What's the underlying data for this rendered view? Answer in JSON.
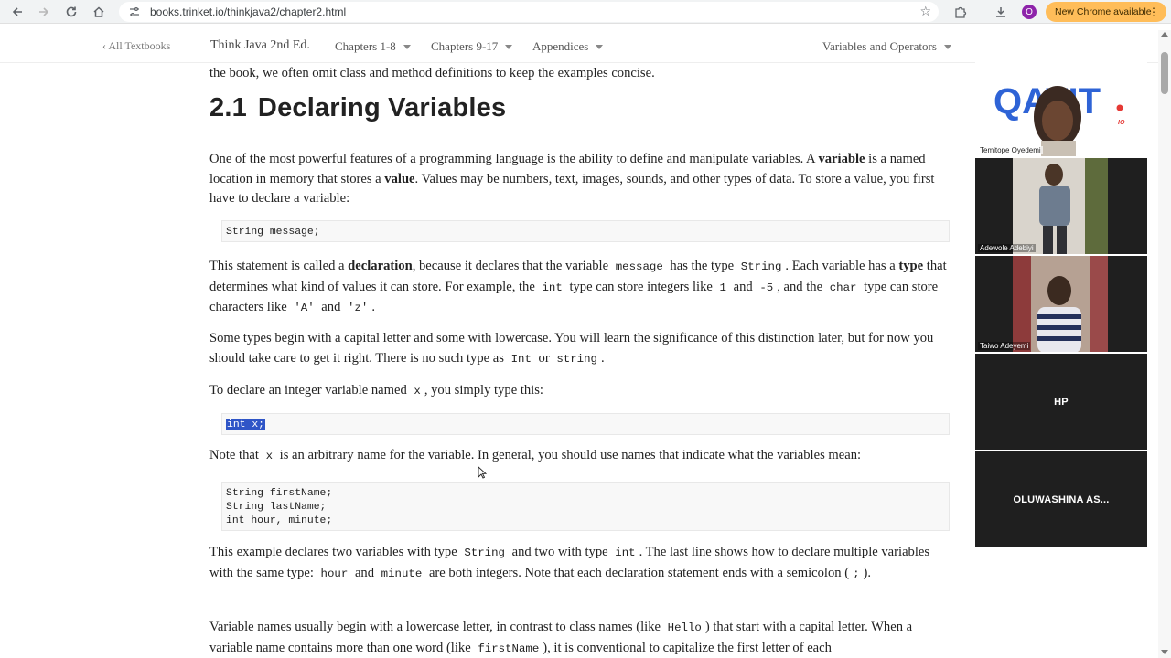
{
  "browser": {
    "url": "books.trinket.io/thinkjava2/chapter2.html",
    "update_label": "New Chrome available",
    "profile_initial": "O"
  },
  "site_nav": {
    "back_link": "‹ All Textbooks",
    "book_title": "Think Java 2nd Ed.",
    "menus": [
      "Chapters 1-8",
      "Chapters 9-17",
      "Appendices"
    ],
    "section_menu": "Variables and Operators"
  },
  "content": {
    "intro_tail": "the book, we often omit class and method definitions to keep the examples concise.",
    "section_number": "2.1",
    "section_title": "Declaring Variables",
    "p1": {
      "a": "One of the most powerful features of a programming language is the ability to define and manipulate variables. A ",
      "b": "variable",
      "c": " is a named location in memory that stores a ",
      "d": "value",
      "e": ". Values may be numbers, text, images, sounds, and other types of data. To store a value, you first have to declare a variable:"
    },
    "code1": "String message;",
    "p2": {
      "a": "This statement is called a ",
      "b": "declaration",
      "c": ", because it declares that the variable ",
      "code_message": "message",
      "d": " has the type ",
      "code_string": "String",
      "e": ". Each variable has a ",
      "f": "type",
      "g": " that determines what kind of values it can store. For example, the ",
      "code_int": "int",
      "h": " type can store integers like ",
      "code_1": "1",
      "i": " and ",
      "code_neg5": "-5",
      "j": ", and the ",
      "code_char": "char",
      "k": " type can store characters like ",
      "code_A": "'A'",
      "l": " and ",
      "code_z": "'z'",
      "m": "."
    },
    "p3": {
      "a": "Some types begin with a capital letter and some with lowercase. You will learn the significance of this distinction later, but for now you should take care to get it right. There is no such type as ",
      "code_Int": "Int",
      "b": " or ",
      "code_string": "string",
      "c": "."
    },
    "p4": {
      "a": "To declare an integer variable named ",
      "code_x": "x",
      "b": ", you simply type this:"
    },
    "code2": "int x;",
    "p5": {
      "a": "Note that ",
      "code_x": "x",
      "b": " is an arbitrary name for the variable. In general, you should use names that indicate what the variables mean:"
    },
    "code3": [
      "String firstName;",
      "String lastName;",
      "int hour, minute;"
    ],
    "p6": {
      "a": "This example declares two variables with type ",
      "code_String": "String",
      "b": " and two with type ",
      "code_int": "int",
      "c": ". The last line shows how to declare multiple variables with the same type: ",
      "code_hour": "hour",
      "d": " and ",
      "code_minute": "minute",
      "e": " are both integers. Note that each declaration statement ends with a semicolon (",
      "code_semi": ";",
      "f": ")."
    },
    "p7": {
      "a": "Variable names usually begin with a lowercase letter, in contrast to class names (like ",
      "code_Hello": "Hello",
      "b": ") that start with a capital letter. When a variable name contains more than one word (like ",
      "code_firstName": "firstName",
      "c": "), it is conventional to capitalize the first letter of each"
    }
  },
  "video_panel": {
    "participants": [
      {
        "name": "Temitope Oyedemi",
        "logo_text": "QATIT",
        "logo_sub": "IO"
      },
      {
        "name": "Adewole Adebiyi"
      },
      {
        "name": "Taiwo Adeyemi"
      },
      {
        "name": "HP"
      },
      {
        "name": "OLUWASHINA  AS..."
      }
    ]
  },
  "colors": {
    "selection": "#2f55c7",
    "update_pill": "#ffbd59",
    "tile_bg": "#1f1f1f"
  }
}
